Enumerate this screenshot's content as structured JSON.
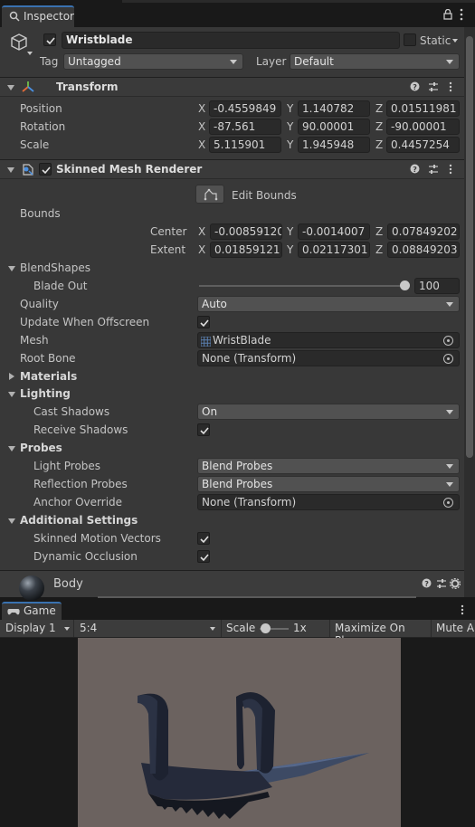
{
  "inspector_tab": {
    "label": "Inspector"
  },
  "object": {
    "name": "Wristblade",
    "static_label": "Static",
    "tag_label": "Tag",
    "tag_value": "Untagged",
    "layer_label": "Layer",
    "layer_value": "Default"
  },
  "transform": {
    "title": "Transform",
    "position_label": "Position",
    "rotation_label": "Rotation",
    "scale_label": "Scale",
    "position": {
      "x": "-0.4559849",
      "y": "1.140782",
      "z": "0.01511981"
    },
    "rotation": {
      "x": "-87.561",
      "y": "90.00001",
      "z": "-90.00001"
    },
    "scale": {
      "x": "5.115901",
      "y": "1.945948",
      "z": "0.4457254"
    }
  },
  "axes": {
    "x": "X",
    "y": "Y",
    "z": "Z"
  },
  "smr": {
    "title": "Skinned Mesh Renderer",
    "edit_bounds": "Edit Bounds",
    "bounds_label": "Bounds",
    "center_label": "Center",
    "extent_label": "Extent",
    "center": {
      "x": "-0.00859120",
      "y": "-0.0014007",
      "z": "0.07849202"
    },
    "extent": {
      "x": "0.01859121",
      "y": "0.02117301",
      "z": "0.08849203"
    },
    "blendshapes_label": "BlendShapes",
    "blade_out_label": "Blade Out",
    "blade_out_value": "100",
    "blade_out_fraction": 1.0,
    "quality_label": "Quality",
    "quality_value": "Auto",
    "update_offscreen_label": "Update When Offscreen",
    "mesh_label": "Mesh",
    "mesh_value": "WristBlade",
    "root_bone_label": "Root Bone",
    "root_bone_value": "None (Transform)",
    "materials_label": "Materials",
    "lighting_label": "Lighting",
    "cast_shadows_label": "Cast Shadows",
    "cast_shadows_value": "On",
    "receive_shadows_label": "Receive Shadows",
    "probes_label": "Probes",
    "light_probes_label": "Light Probes",
    "light_probes_value": "Blend Probes",
    "reflection_probes_label": "Reflection Probes",
    "reflection_probes_value": "Blend Probes",
    "anchor_override_label": "Anchor Override",
    "anchor_override_value": "None (Transform)",
    "additional_label": "Additional Settings",
    "skinned_motion_label": "Skinned Motion Vectors",
    "dynamic_occlusion_label": "Dynamic Occlusion"
  },
  "material": {
    "name": "Body"
  },
  "game": {
    "tab_label": "Game",
    "display_value": "Display 1",
    "aspect_value": "5:4",
    "scale_label": "Scale",
    "scale_value": "1x",
    "maximize_label": "Maximize On Play",
    "mute_label": "Mute Au"
  },
  "colors": {
    "panel": "#383838",
    "header": "#3a3a3a",
    "field": "#2a2a2a",
    "dropdown": "#515151",
    "viewport_bg": "#6b625f"
  }
}
